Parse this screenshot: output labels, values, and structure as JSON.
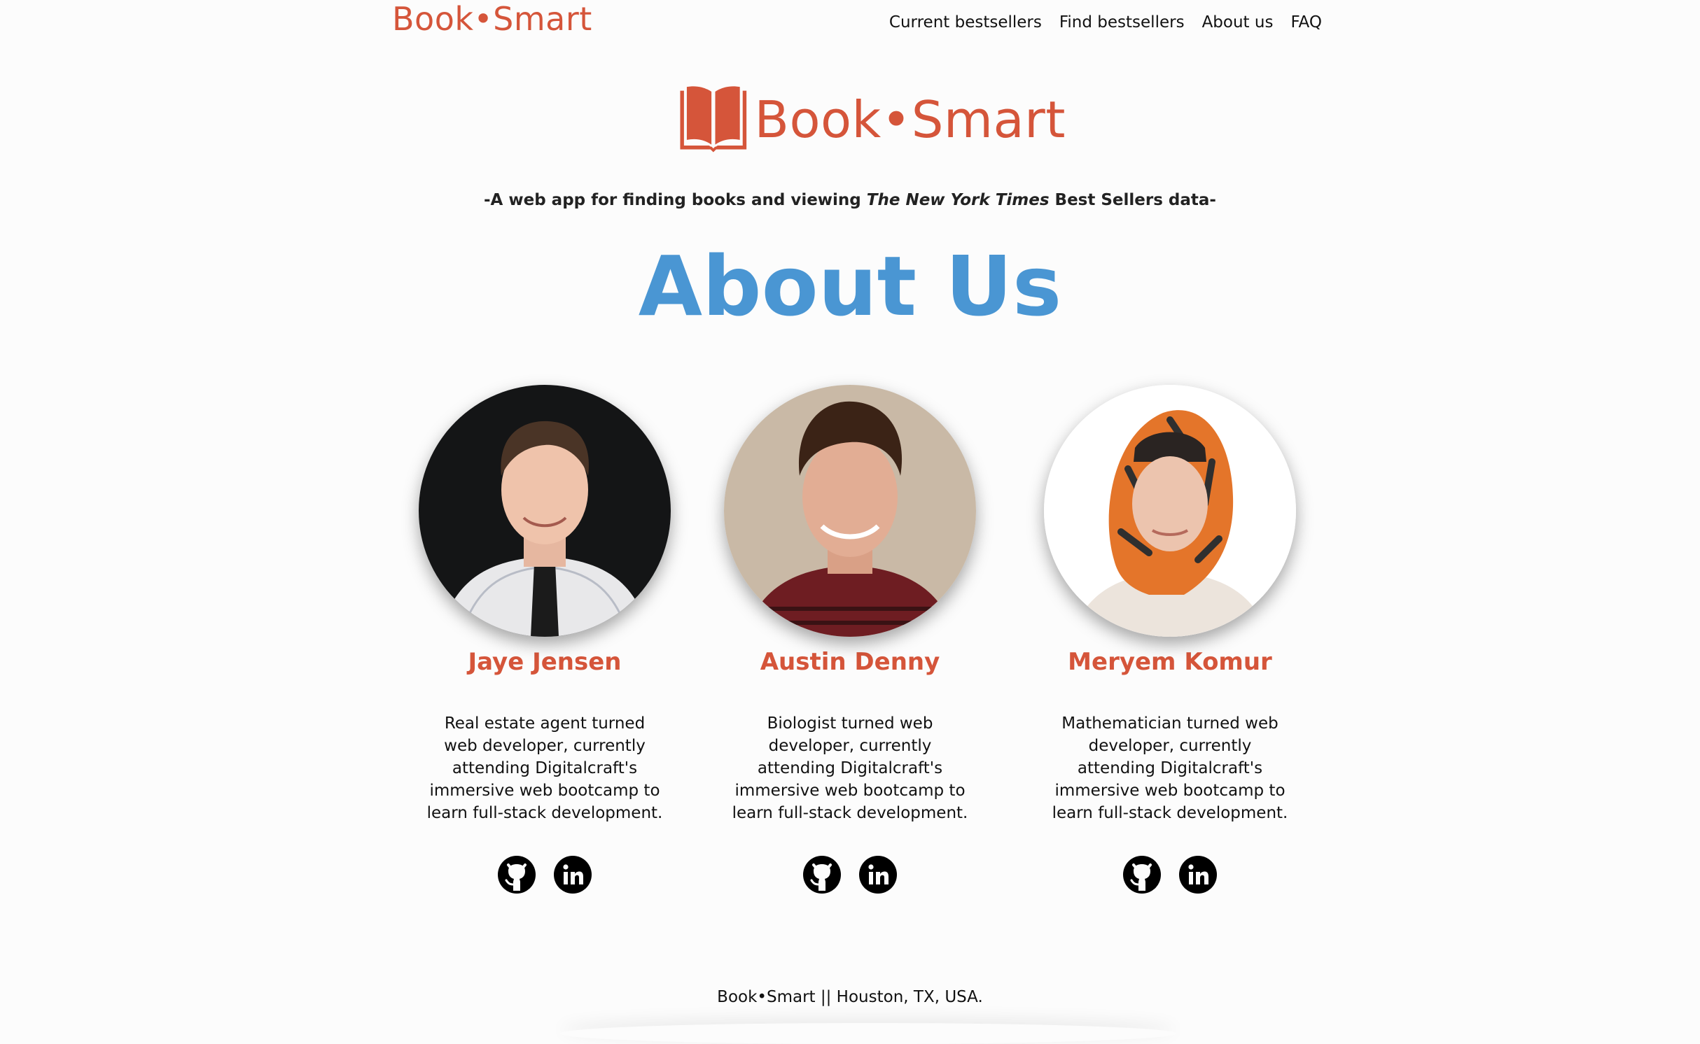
{
  "nav": {
    "brand": "Book•Smart",
    "links": [
      "Current bestsellers",
      "Find bestsellers",
      "About us",
      "FAQ"
    ]
  },
  "hero": {
    "logo_text": "Book•Smart",
    "logo_icon": "open-book-icon",
    "tagline_before": "-A web app for finding books and viewing ",
    "tagline_em": "The New York Times",
    "tagline_after": " Best Sellers data-"
  },
  "page": {
    "title": "About Us"
  },
  "team": [
    {
      "name": "Jaye Jensen",
      "bio": "Real estate agent turned web developer, currently attending Digitalcraft's immersive web bootcamp to learn full-stack development."
    },
    {
      "name": "Austin Denny",
      "bio": "Biologist turned web developer, currently attending Digitalcraft's immersive web bootcamp to learn full-stack development."
    },
    {
      "name": "Meryem Komur",
      "bio": "Mathematician turned web developer, currently attending Digitalcraft's immersive web bootcamp to learn full-stack development."
    }
  ],
  "social_icons": [
    "github-icon",
    "linkedin-icon"
  ],
  "footer": {
    "text": "Book•Smart || Houston, TX, USA."
  },
  "colors": {
    "brand": "#d5553a",
    "title": "#4a96d3",
    "text": "#111111",
    "background": "#fcfcfc"
  }
}
